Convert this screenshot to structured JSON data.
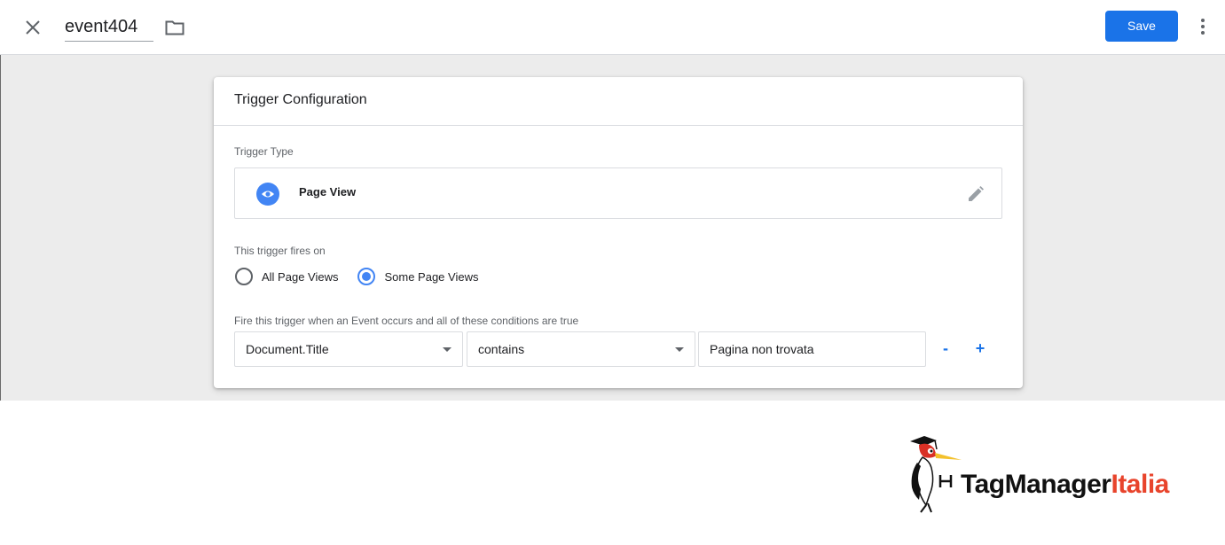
{
  "header": {
    "title": "event404",
    "save_label": "Save",
    "icons": {
      "close": "close-icon",
      "folder": "folder-icon",
      "more": "more-vert-icon"
    }
  },
  "card": {
    "title": "Trigger Configuration",
    "trigger_type_label": "Trigger Type",
    "trigger_type": {
      "name": "Page View",
      "icon": "eye-icon",
      "edit_icon": "pencil-icon"
    },
    "fires_on_label": "This trigger fires on",
    "fires_on_options": [
      {
        "label": "All Page Views",
        "selected": false
      },
      {
        "label": "Some Page Views",
        "selected": true
      }
    ],
    "conditions_label": "Fire this trigger when an Event occurs and all of these conditions are true",
    "condition": {
      "variable": "Document.Title",
      "operator": "contains",
      "value": "Pagina non trovata",
      "remove_label": "-",
      "add_label": "+"
    }
  },
  "branding": {
    "logo_part1": "TagManager",
    "logo_part2": "Italia"
  },
  "colors": {
    "accent": "#1a73e8",
    "radio_selected": "#4285f4",
    "logo_red": "#e8442c"
  }
}
